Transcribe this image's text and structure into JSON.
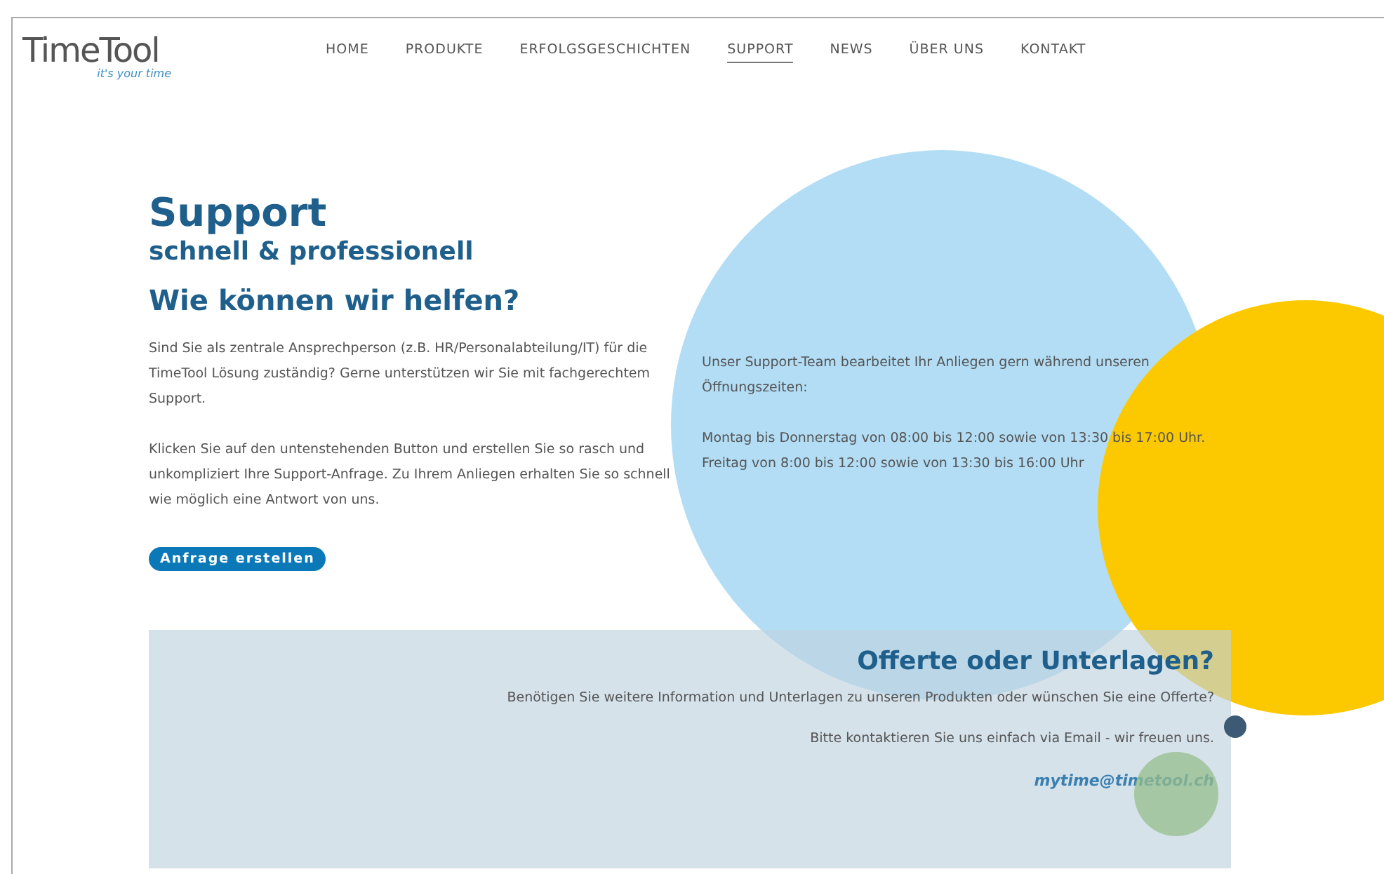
{
  "logo": {
    "name": "TimeTool",
    "tagline": "it's your time"
  },
  "nav": [
    {
      "label": "HOME",
      "selected": false
    },
    {
      "label": "PRODUKTE",
      "selected": false
    },
    {
      "label": "ERFOLGSGESCHICHTEN",
      "selected": false
    },
    {
      "label": "SUPPORT",
      "selected": true
    },
    {
      "label": "NEWS",
      "selected": false
    },
    {
      "label": "ÜBER UNS",
      "selected": false
    },
    {
      "label": "KONTAKT",
      "selected": false
    }
  ],
  "hero": {
    "title": "Support",
    "subtitle": "schnell & professionell",
    "heading": "Wie können wir helfen?",
    "paragraphs": [
      "Sind Sie als zentrale Ansprechperson (z.B. HR/Personalabteilung/IT) für die TimeTool Lösung zuständig? Gerne unterstützen wir Sie mit fachgerechtem Support.",
      "Klicken Sie auf den untenstehenden Button und erstellen Sie so rasch und unkompliziert Ihre Support-Anfrage. Zu Ihrem Anliegen erhalten Sie so schnell wie möglich eine Antwort von uns."
    ],
    "button": "Anfrage erstellen"
  },
  "hours": {
    "intro": "Unser Support-Team bearbeitet Ihr Anliegen gern während unseren Öffnungszeiten:",
    "lines": [
      "Montag bis Donnerstag von 08:00 bis 12:00 sowie von 13:30 bis 17:00 Uhr.",
      "Freitag von 8:00 bis 12:00 sowie von 13:30 bis 16:00 Uhr"
    ]
  },
  "offer": {
    "heading": "Offerte oder Unterlagen?",
    "question": "Benötigen Sie weitere Information und Unterlagen zu unseren Produkten oder wünschen Sie eine Offerte?",
    "contact": "Bitte kontaktieren Sie uns einfach via Email - wir freuen uns.",
    "email": "mytime@timetool.ch"
  }
}
